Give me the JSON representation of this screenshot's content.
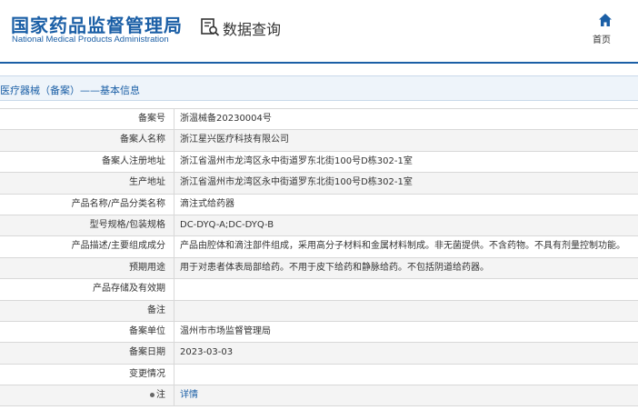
{
  "header": {
    "logo_cn": "国家药品监督管理局",
    "logo_en": "National Medical Products Administration",
    "query_title": "数据查询",
    "home_label": "首页"
  },
  "breadcrumb": {
    "text": "医疗器械（备案）——基本信息"
  },
  "rows": [
    {
      "label": "备案号",
      "value": "浙温械备20230004号"
    },
    {
      "label": "备案人名称",
      "value": "浙江星兴医疗科技有限公司"
    },
    {
      "label": "备案人注册地址",
      "value": "浙江省温州市龙湾区永中街道罗东北街100号D栋302-1室"
    },
    {
      "label": "生产地址",
      "value": "浙江省温州市龙湾区永中街道罗东北街100号D栋302-1室"
    },
    {
      "label": "产品名称/产品分类名称",
      "value": "滴注式给药器"
    },
    {
      "label": "型号规格/包装规格",
      "value": "DC-DYQ-A;DC-DYQ-B"
    },
    {
      "label": "产品描述/主要组成成分",
      "value": "产品由腔体和滴注部件组成，采用高分子材料和金属材料制成。非无菌提供。不含药物。不具有剂量控制功能。"
    },
    {
      "label": "预期用途",
      "value": "用于对患者体表局部给药。不用于皮下给药和静脉给药。不包括阴道给药器。"
    },
    {
      "label": "产品存储及有效期",
      "value": ""
    },
    {
      "label": "备注",
      "value": ""
    },
    {
      "label": "备案单位",
      "value": "温州市市场监督管理局"
    },
    {
      "label": "备案日期",
      "value": "2023-03-03"
    },
    {
      "label": "变更情况",
      "value": ""
    },
    {
      "label": "注",
      "value": "详情"
    }
  ],
  "colors": {
    "brand": "#1b5fa6",
    "breadcrumb_bg": "#eef4fa",
    "row_alt": "#f4f4f4"
  },
  "icons": {
    "query": "search-document-icon",
    "home": "home-icon",
    "note": "dot-marker-icon"
  }
}
